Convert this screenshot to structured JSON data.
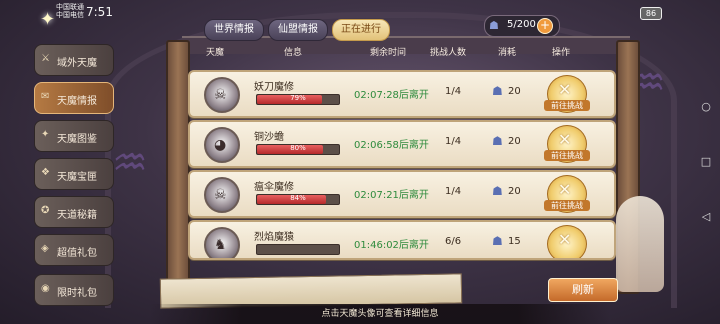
{
  "status_bar": {
    "carrier_line1": "中国联通",
    "carrier_line2": "中国电信",
    "time": "7:51",
    "battery": "86"
  },
  "tabs": [
    {
      "label": "世界情报",
      "active": false
    },
    {
      "label": "仙盟情报",
      "active": false
    },
    {
      "label": "正在进行",
      "active": true
    }
  ],
  "stamina": {
    "value": "5/200",
    "icon": "demon-head-icon",
    "plus": "+"
  },
  "sidebar": {
    "items": [
      {
        "label": "域外天魔",
        "icon": "⚔",
        "active": false
      },
      {
        "label": "天魔情报",
        "icon": "✉",
        "active": true
      },
      {
        "label": "天魔图鉴",
        "icon": "✦",
        "active": false
      },
      {
        "label": "天魔宝匣",
        "icon": "❖",
        "active": false
      },
      {
        "label": "天道秘籍",
        "icon": "✪",
        "active": false
      },
      {
        "label": "超值礼包",
        "icon": "◈",
        "active": false
      },
      {
        "label": "限时礼包",
        "icon": "◉",
        "active": false
      }
    ]
  },
  "table": {
    "headers": [
      "天魔",
      "信息",
      "剩余时间",
      "挑战人数",
      "消耗",
      "操作"
    ],
    "rows": [
      {
        "name": "妖刀魔修",
        "hp": "79%",
        "hp_value": 79,
        "time": "02:07:28后离开",
        "count": "1/4",
        "cost": "20",
        "action": "前往挑战",
        "face": "☠"
      },
      {
        "name": "铜沙蟾",
        "hp": "80%",
        "hp_value": 80,
        "time": "02:06:58后离开",
        "count": "1/4",
        "cost": "20",
        "action": "前往挑战",
        "face": "◕"
      },
      {
        "name": "瘟伞魔修",
        "hp": "84%",
        "hp_value": 84,
        "time": "02:07:21后离开",
        "count": "1/4",
        "cost": "20",
        "action": "前往挑战",
        "face": "☠"
      },
      {
        "name": "烈焰魔猿",
        "hp": "",
        "hp_value": 0,
        "time": "01:46:02后离开",
        "count": "6/6",
        "cost": "15",
        "action": "",
        "face": "♞"
      }
    ]
  },
  "refresh_button": "刷新",
  "hint": "点击天魔头像可查看详细信息",
  "nav_icons": [
    "circle-nav-icon",
    "square-nav-icon",
    "back-nav-icon"
  ],
  "colors": {
    "accent": "#e2c279",
    "time_green": "#2e8b3c",
    "hp_red": "#c93b3b"
  }
}
